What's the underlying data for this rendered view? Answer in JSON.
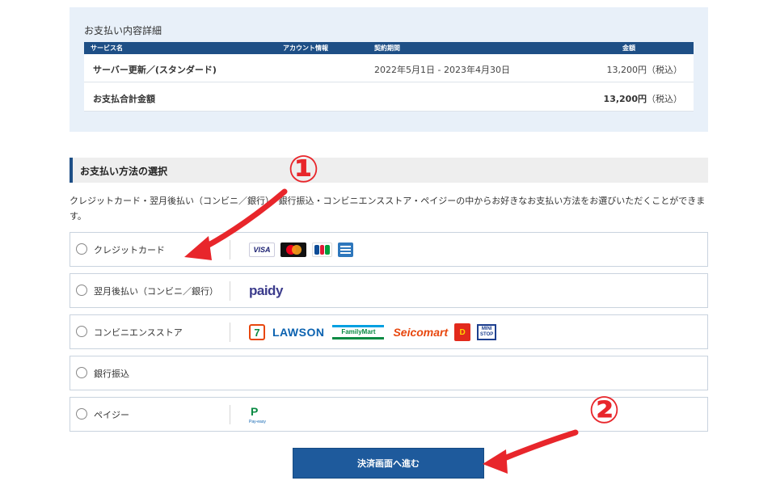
{
  "summary": {
    "title": "お支払い内容詳細",
    "columns": [
      "サービス名",
      "アカウント情報",
      "契約期間",
      "金額"
    ],
    "rows": [
      {
        "service": "サーバー更新／(スタンダード)",
        "account": "",
        "period": "2022年5月1日 - 2023年4月30日",
        "amount": "13,200円",
        "tax": "（税込）"
      }
    ],
    "total": {
      "label": "お支払合計金額",
      "amount": "13,200円",
      "tax": "（税込）"
    }
  },
  "payment_method": {
    "heading": "お支払い方法の選択",
    "description": "クレジットカード・翌月後払い（コンビニ／銀行）・銀行振込・コンビニエンスストア・ペイジーの中からお好きなお支払い方法をお選びいただくことができます。",
    "options": [
      {
        "label": "クレジットカード",
        "selected": false,
        "logos": [
          "visa-logo",
          "mastercard-logo",
          "jcb-logo",
          "amex-logo"
        ]
      },
      {
        "label": "翌月後払い（コンビニ／銀行）",
        "selected": false,
        "logos": [
          "paidy-logo"
        ]
      },
      {
        "label": "コンビニエンスストア",
        "selected": false,
        "logos": [
          "seven-eleven-logo",
          "lawson-logo",
          "familymart-logo",
          "seicomart-logo",
          "daily-yamazaki-logo",
          "ministop-logo"
        ]
      },
      {
        "label": "銀行振込",
        "selected": false,
        "logos": []
      },
      {
        "label": "ペイジー",
        "selected": false,
        "logos": [
          "payeasy-logo"
        ]
      }
    ],
    "logo_text": {
      "visa": "VISA",
      "paidy": "paidy",
      "seven": "7",
      "lawson": "LAWSON",
      "familymart": "FamilyMart",
      "seicomart": "Seicomart",
      "daily": "D",
      "ministop_1": "MINI",
      "ministop_2": "STOP",
      "payeasy_p": "P",
      "payeasy_t": "Pay-easy"
    }
  },
  "submit_button": {
    "label": "決済画面へ進む"
  },
  "annotations": {
    "marker_1": "①",
    "marker_2": "②",
    "color": "#e8262b"
  },
  "colors": {
    "primary": "#1e4f86",
    "button": "#1e5a9c",
    "summary_bg": "#e8f0f9"
  }
}
